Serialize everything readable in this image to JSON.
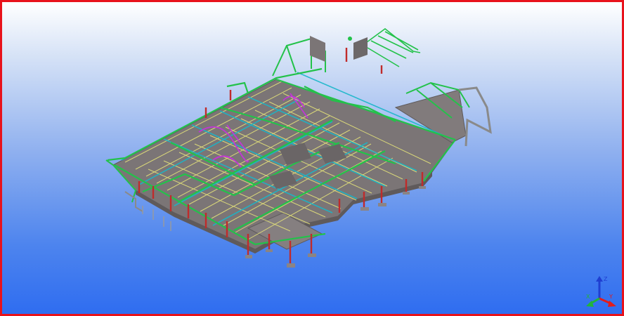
{
  "viewport": {
    "border_color": "#e8121b",
    "background_top": "#ffffff",
    "background_bottom": "#2f6df0"
  },
  "model": {
    "slab_color": "#7b7576",
    "beam_green": "#23c24a",
    "beam_cyan": "#19b7c9",
    "beam_yellow": "#e4e27a",
    "beam_magenta": "#c236d6",
    "column_red": "#c02b2b",
    "frame_gray": "#8a8a8a"
  },
  "axis_triad": {
    "x_label": "X",
    "y_label": "Y",
    "z_label": "Z",
    "x_color": "#e21c1c",
    "y_color": "#22b33a",
    "z_color": "#1f3ed1"
  }
}
